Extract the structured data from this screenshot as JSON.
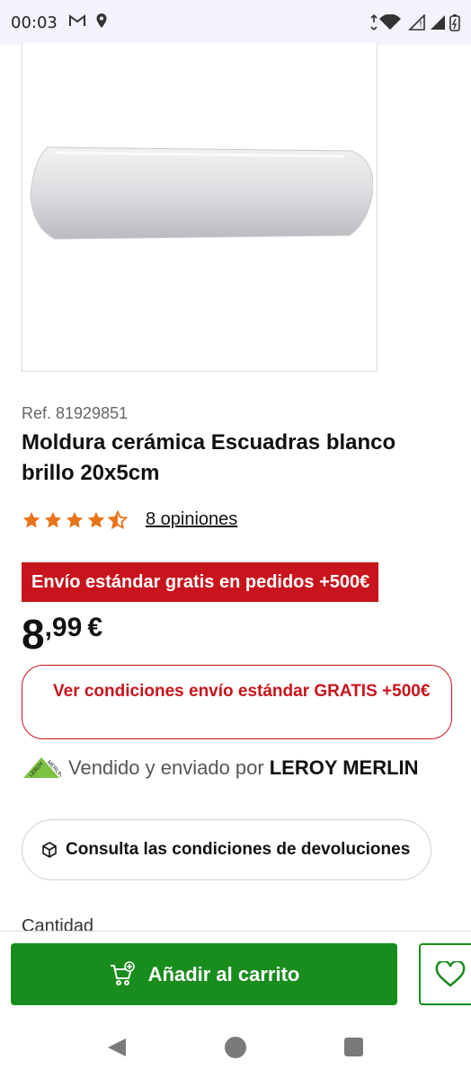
{
  "status_bar": {
    "time": "00:03"
  },
  "product": {
    "ref": "Ref. 81929851",
    "title": "Moldura cerámica Escuadras blanco brillo 20x5cm",
    "rating": 4.5,
    "opinions_label": "8 opiniones",
    "promo_banner": "Envío estándar gratis en pedidos +500€",
    "price_integer": "8",
    "price_decimals": ",99",
    "price_currency": "€",
    "conditions_link": "Ver condiciones envío estándar GRATIS +500€",
    "seller_prefix": "Vendido y enviado por",
    "seller_name": "LEROY MERLIN",
    "returns_button": "Consulta las condiciones de devoluciones",
    "quantity_label": "Cantidad"
  },
  "actions": {
    "add_to_cart": "Añadir al carrito"
  },
  "colors": {
    "brand_green": "#188c1c",
    "promo_red": "#c8141c",
    "star_orange": "#e8731a"
  }
}
